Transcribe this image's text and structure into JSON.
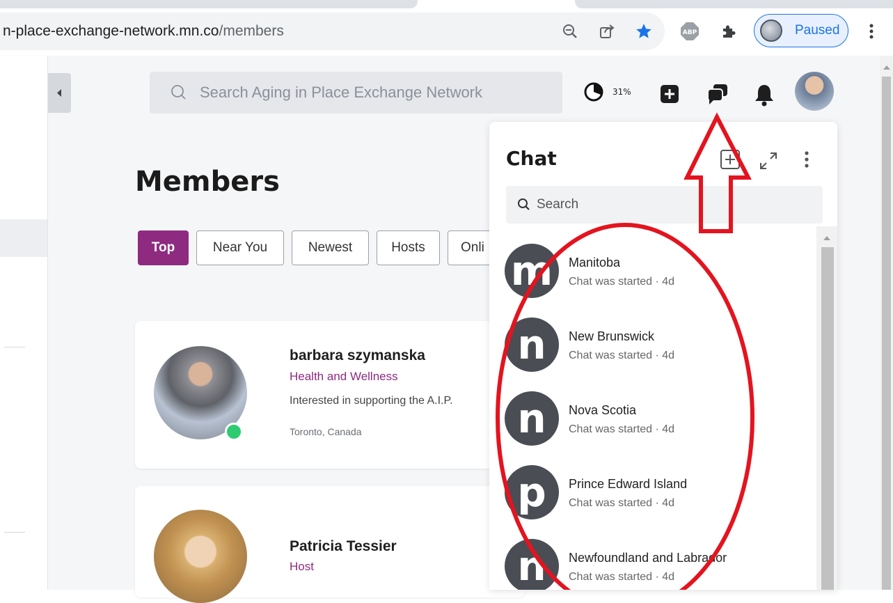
{
  "browser": {
    "url_host": "n-place-exchange-network.mn.co",
    "url_path": "/members",
    "profile_status": "Paused",
    "abp_badge": "ABP",
    "icons": [
      "zoom-out-icon",
      "share-icon",
      "bookmark-star-icon",
      "adblock-icon",
      "extensions-puzzle-icon",
      "profile-avatar",
      "more-vert-icon"
    ],
    "accent": "#1a73e8"
  },
  "header": {
    "search_placeholder": "Search Aging in Place Exchange Network",
    "progress_label": "31%",
    "progress_value": 0.31
  },
  "members_page": {
    "title": "Members",
    "filter_tabs": [
      "Top",
      "Near You",
      "Newest",
      "Hosts",
      "Onli"
    ],
    "active_tab": "Top",
    "accent": "#8e2b80",
    "members": [
      {
        "name": "barbara szymanska",
        "role": "Health and Wellness",
        "bio": "Interested in supporting the A.I.P.",
        "location": "Toronto, Canada",
        "online": true
      },
      {
        "name": "Patricia Tessier",
        "role": "Host"
      }
    ]
  },
  "chat": {
    "title": "Chat",
    "search_placeholder": "Search",
    "conversations": [
      {
        "initial": "m",
        "name": "Manitoba",
        "status": "Chat was started",
        "age": "4d"
      },
      {
        "initial": "n",
        "name": "New Brunswick",
        "status": "Chat was started",
        "age": "4d"
      },
      {
        "initial": "n",
        "name": "Nova Scotia",
        "status": "Chat was started",
        "age": "4d"
      },
      {
        "initial": "p",
        "name": "Prince Edward Island",
        "status": "Chat was started",
        "age": "4d"
      },
      {
        "initial": "n",
        "name": "Newfoundland and Labrador",
        "status": "Chat was started",
        "age": "4d"
      }
    ]
  },
  "annotation": {
    "color": "#e3141f"
  }
}
